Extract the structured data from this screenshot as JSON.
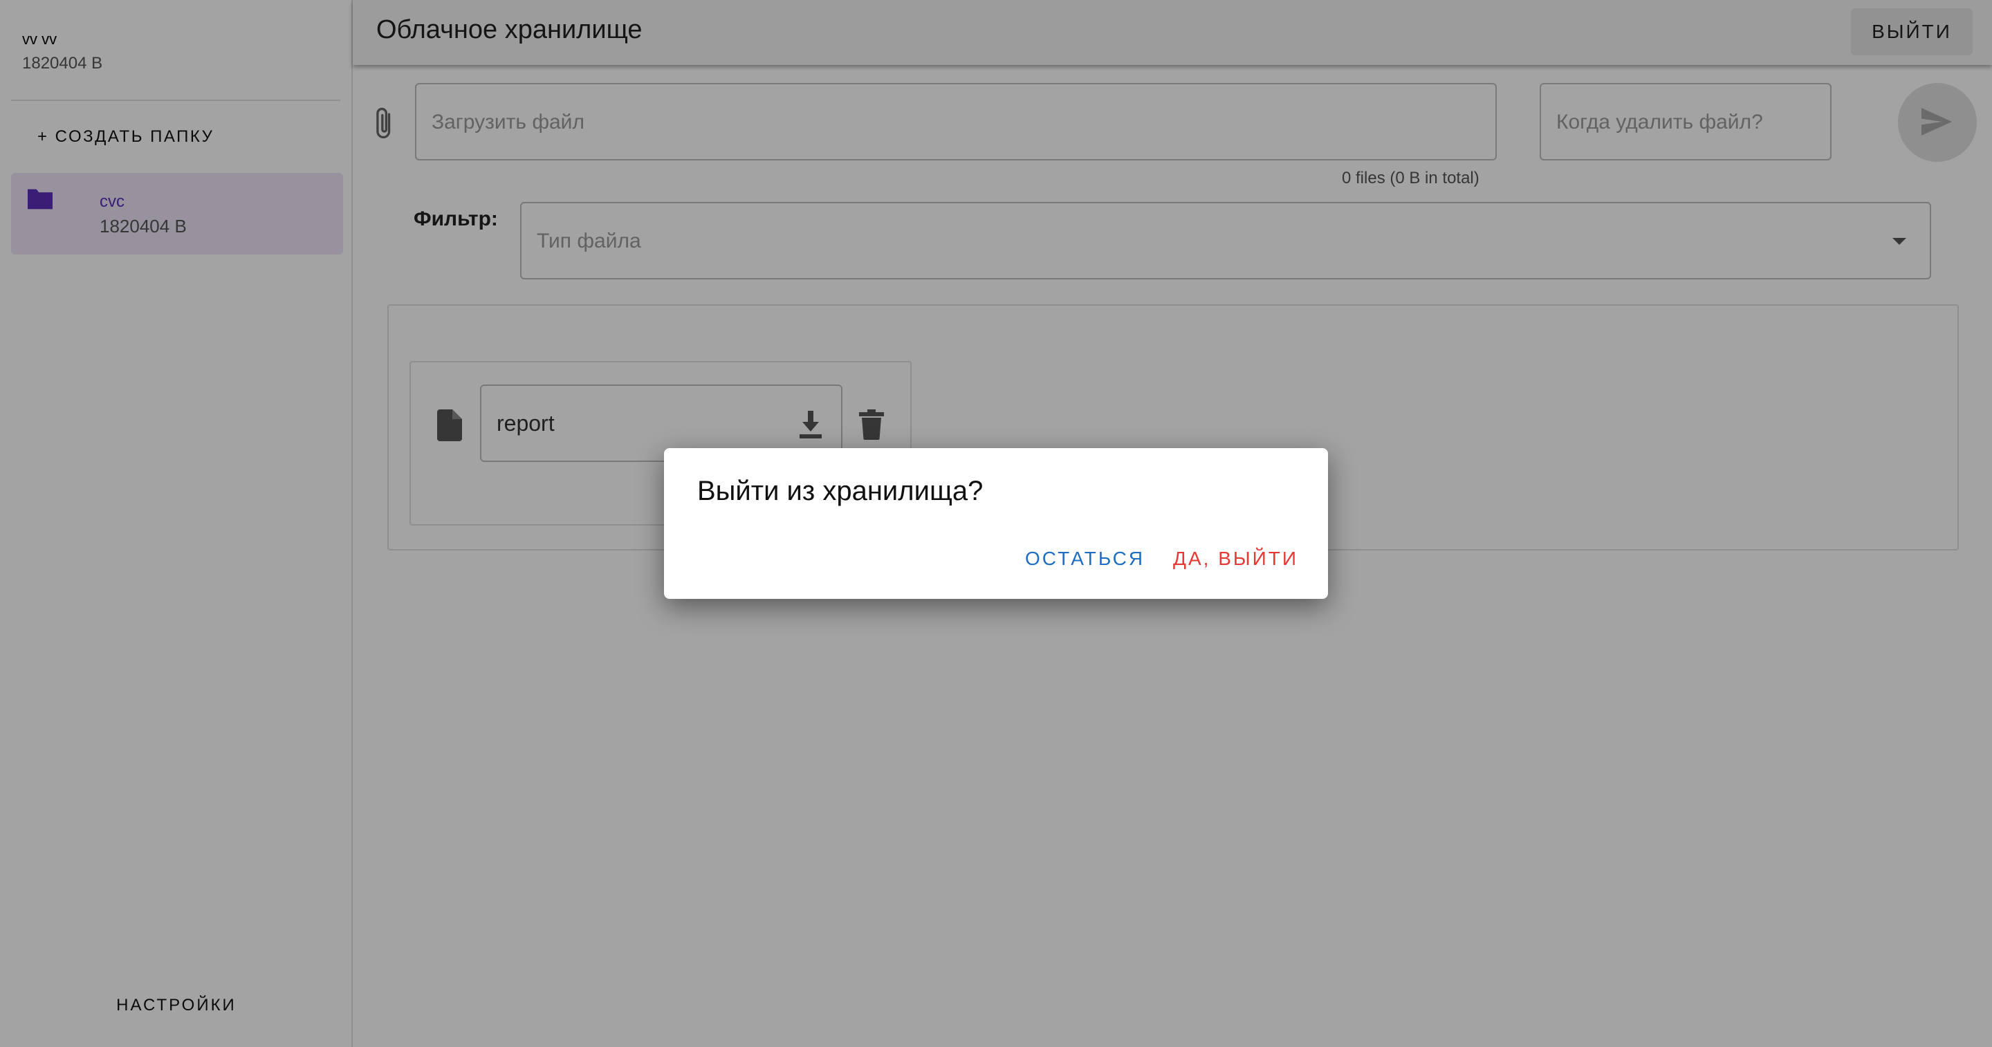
{
  "sidebar": {
    "user_name": "vv vv",
    "user_size": "1820404 B",
    "create_folder_label": "+ СОЗДАТЬ ПАПКУ",
    "folders": [
      {
        "name": "cvc",
        "size": "1820404 B"
      }
    ],
    "settings_label": "НАСТРОЙКИ"
  },
  "header": {
    "title": "Облачное хранилище",
    "logout_label": "ВЫЙТИ"
  },
  "upload": {
    "file_placeholder": "Загрузить файл",
    "delete_when_placeholder": "Когда удалить файл?",
    "files_info": "0 files (0 B in total)"
  },
  "filter": {
    "label": "Фильтр:",
    "type_placeholder": "Тип файла"
  },
  "files": [
    {
      "name": "report"
    }
  ],
  "dialog": {
    "title": "Выйти из хранилища?",
    "stay_label": "ОСТАТЬСЯ",
    "confirm_label": "ДА, ВЫЙТИ"
  },
  "colors": {
    "folder_icon": "#5b2eb8",
    "stay": "#1e6fc2",
    "confirm": "#e53935"
  },
  "icons": [
    "paperclip-icon",
    "send-icon",
    "folder-icon",
    "document-icon",
    "download-icon",
    "trash-icon",
    "chevron-down-icon"
  ]
}
